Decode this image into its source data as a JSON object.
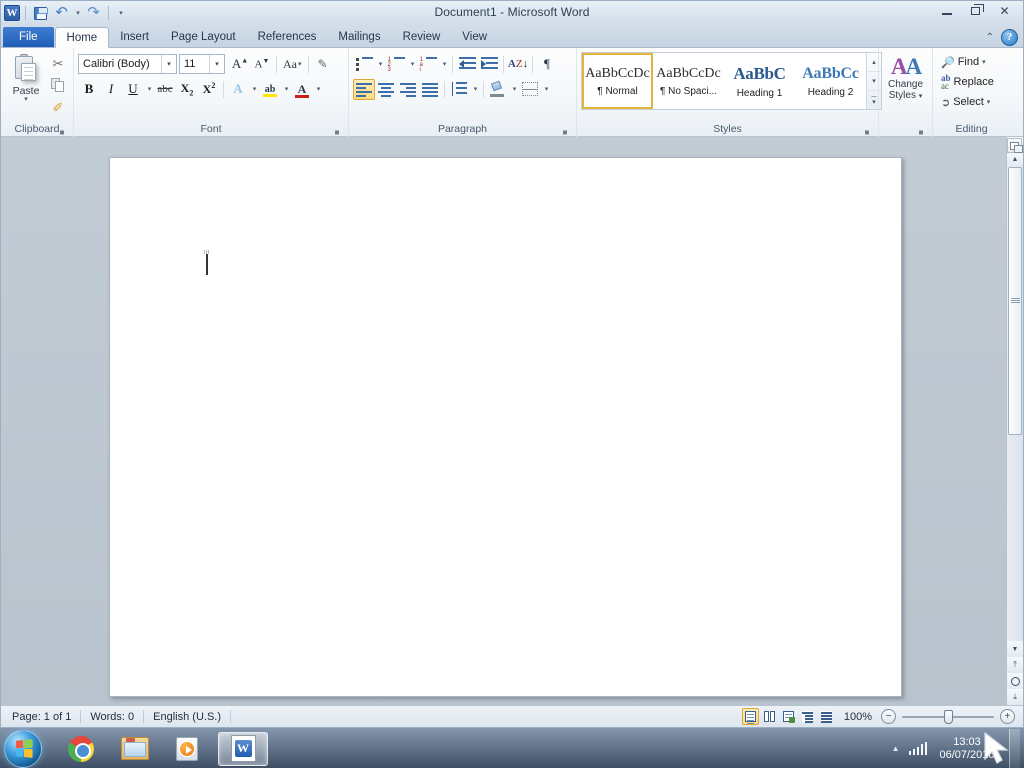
{
  "window": {
    "title": "Document1  -  Microsoft Word",
    "app_logo": "W",
    "controls": {
      "minimize": "minimize-icon",
      "restore": "restore-icon",
      "close": "✕"
    }
  },
  "quick_access": {
    "save": "save-icon",
    "undo": "↶",
    "redo": "↷",
    "customize": "▾"
  },
  "ribbon_controls": {
    "collapse": "⌃",
    "help": "?"
  },
  "tabs": [
    {
      "label": "File",
      "active": false,
      "kind": "file"
    },
    {
      "label": "Home",
      "active": true,
      "kind": "normal"
    },
    {
      "label": "Insert",
      "active": false,
      "kind": "normal"
    },
    {
      "label": "Page Layout",
      "active": false,
      "kind": "normal"
    },
    {
      "label": "References",
      "active": false,
      "kind": "normal"
    },
    {
      "label": "Mailings",
      "active": false,
      "kind": "normal"
    },
    {
      "label": "Review",
      "active": false,
      "kind": "normal"
    },
    {
      "label": "View",
      "active": false,
      "kind": "normal"
    }
  ],
  "groups": {
    "clipboard": {
      "label": "Clipboard",
      "paste": "Paste",
      "paste_arrow": "▾",
      "cut": "✂",
      "copy": "copy-icon",
      "format_painter": "✐",
      "dialog_launcher": "dialog-launcher"
    },
    "font": {
      "label": "Font",
      "font_name": "Calibri (Body)",
      "font_size": "11",
      "grow_font": "A",
      "shrink_font": "A",
      "change_case": "Aa",
      "clear_formatting": "clear-formatting",
      "bold": "B",
      "italic": "I",
      "underline": "U",
      "strikethrough": "abc",
      "subscript": "X",
      "superscript": "X",
      "text_effects": "A",
      "highlight": "ab",
      "font_color": "A",
      "dropdown": "▾",
      "dialog_launcher": "dialog-launcher"
    },
    "paragraph": {
      "label": "Paragraph",
      "bullets": "bullets",
      "numbering": "numbering",
      "multilevel": "multilevel-list",
      "decrease_indent": "decrease-indent",
      "increase_indent": "increase-indent",
      "sort_a": "A",
      "sort_z": "Z",
      "sort_arrow": "↓",
      "show_marks": "¶",
      "align_left": "align-left",
      "align_center": "align-center",
      "align_right": "align-right",
      "justify": "justify",
      "line_spacing": "line-spacing",
      "shading": "shading",
      "borders": "borders",
      "dropdown": "▾",
      "dialog_launcher": "dialog-launcher",
      "active_alignment": "align-left"
    },
    "styles": {
      "label": "Styles",
      "items": [
        {
          "preview": "AaBbCcDc",
          "name": "¶ Normal",
          "selected": true,
          "kind": "body"
        },
        {
          "preview": "AaBbCcDc",
          "name": "¶ No Spaci...",
          "selected": false,
          "kind": "body"
        },
        {
          "preview": "AaBbC",
          "name": "Heading 1",
          "selected": false,
          "kind": "h1"
        },
        {
          "preview": "AaBbCc",
          "name": "Heading 2",
          "selected": false,
          "kind": "h2"
        }
      ],
      "scroll_up": "▴",
      "scroll_down": "▾",
      "more": "▾",
      "dialog_launcher": "dialog-launcher"
    },
    "change_styles": {
      "label_line1": "Change",
      "label_line2": "Styles",
      "icon_left": "A",
      "icon_right": "A",
      "dropdown": "▾"
    },
    "editing": {
      "label": "Editing",
      "find": "Find",
      "replace": "Replace",
      "select": "Select",
      "dropdown": "▾"
    }
  },
  "document": {
    "content": "",
    "caret_visible": true
  },
  "scrollbar": {
    "split_window": "split-window",
    "scroll_up": "▲",
    "scroll_down": "▼",
    "previous_page": "⤒",
    "browse_object": "browse-object",
    "next_page": "⤓",
    "ruler_toggle": "view-ruler"
  },
  "status_bar": {
    "page": "Page: 1 of 1",
    "words": "Words: 0",
    "language": "English (U.S.)",
    "views": [
      {
        "name": "print-layout",
        "active": true
      },
      {
        "name": "full-screen-reading",
        "active": false
      },
      {
        "name": "web-layout",
        "active": false
      },
      {
        "name": "outline",
        "active": false
      },
      {
        "name": "draft",
        "active": false
      }
    ],
    "zoom_level": "100%",
    "zoom_out": "−",
    "zoom_in": "+"
  },
  "taskbar": {
    "start": "windows-start",
    "items": [
      {
        "name": "chrome",
        "active": false
      },
      {
        "name": "windows-explorer",
        "active": false
      },
      {
        "name": "windows-media-player",
        "active": false
      },
      {
        "name": "microsoft-word",
        "active": true,
        "glyph": "W"
      }
    ],
    "tray": {
      "show_hidden": "▲",
      "network": "network-signal",
      "time": "13:03",
      "date": "06/07/2010"
    }
  },
  "colors": {
    "accent_blue": "#1f5cb5",
    "ribbon_bg": "#fdfdfd",
    "selected_gold": "#e3b53c",
    "highlight_yellow": "#ffe400",
    "font_color_red": "#cc1f18",
    "heading_blue": "#29588f"
  }
}
